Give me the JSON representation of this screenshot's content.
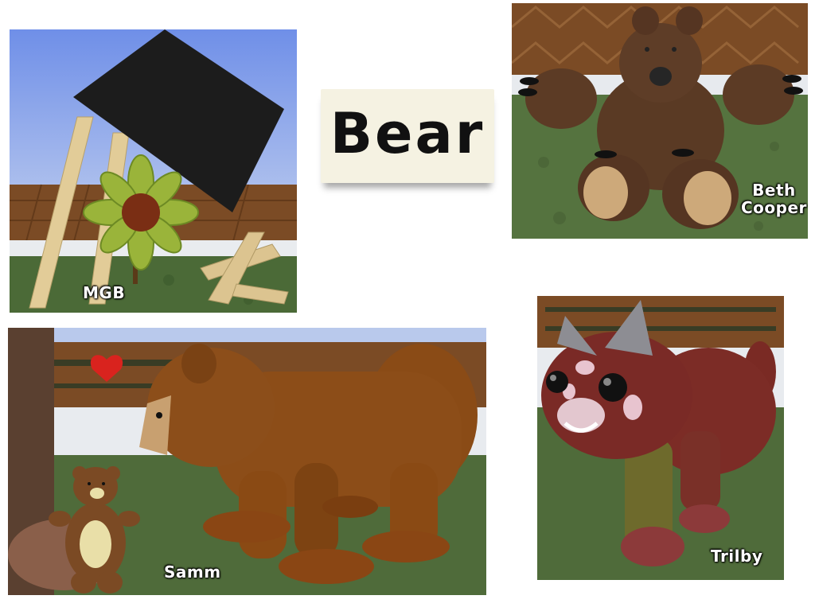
{
  "title": "Bear",
  "panels": {
    "mgb": {
      "caption": "MGB"
    },
    "beth": {
      "caption_line1": "Beth",
      "caption_line2": "Cooper"
    },
    "samm": {
      "caption": "Samm"
    },
    "trilby": {
      "caption": "Trilby"
    }
  },
  "colors": {
    "background": "#ffffff",
    "title_card": "#f5f2e2",
    "title_ink": "#111111",
    "caption_text": "#ffffff",
    "grass": "#4e6b3a",
    "wood_wall": "#7a4a24",
    "brown_bear": "#5a3a24",
    "orange_bear": "#8a4a14",
    "red_panda": "#7a2a24"
  }
}
